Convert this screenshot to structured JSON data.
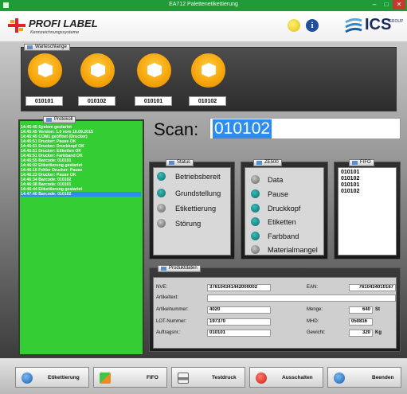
{
  "window": {
    "title": "EA712 Palettenetikettierung",
    "minimize": "–",
    "maximize": "□",
    "close": "✕"
  },
  "header": {
    "brand": "PROFI LABEL",
    "brand_sub": "Kennzeichnungssysteme",
    "partner": "ICS",
    "partner_suffix": "GROUP",
    "icons": [
      "moon-icon",
      "info-icon"
    ]
  },
  "queue": {
    "title": "Warteschlange",
    "items": [
      "010101",
      "010102",
      "010101",
      "010102"
    ]
  },
  "protokoll": {
    "title": "Protokoll",
    "lines": [
      "14:45:45  System gestartet",
      "14:45:45  Version: 1.0 vom 10.09.2015",
      "14:45:45  COM1 geöffnet (Drucker)",
      "14:45:51  Drucker: Pause OK",
      "14:45:51  Drucker: Druckkopf OK",
      "14:45:51  Drucker: Etiketten OK",
      "14:45:51  Drucker: Farbband OK",
      "14:45:55  Barcode: 010101",
      "14:46:02  Etikettierung gestartet",
      "14:46:16  Fehler Drucker: Pause",
      "14:46:23  Drucker: Pause OK",
      "14:46:34  Barcode: 010102",
      "14:46:38  Barcode: 010101",
      "14:46:44  Etikettierung gestartet",
      "14:47:40  Barcode: 010102"
    ],
    "selected_index": 14
  },
  "scan": {
    "label": "Scan:",
    "value": "010102"
  },
  "status": {
    "title": "Status",
    "items": [
      {
        "label": "Betriebsbereit",
        "state": "teal"
      },
      {
        "label": "Grundstellung",
        "state": "teal"
      },
      {
        "label": "Etikettierung",
        "state": "grey"
      },
      {
        "label": "Störung",
        "state": "grey"
      }
    ]
  },
  "ze500": {
    "title": "ZE500",
    "items": [
      {
        "label": "Data",
        "state": "grey"
      },
      {
        "label": "Pause",
        "state": "teal"
      },
      {
        "label": "Druckkopf",
        "state": "teal"
      },
      {
        "label": "Etiketten",
        "state": "teal"
      },
      {
        "label": "Farbband",
        "state": "teal"
      },
      {
        "label": "Materialmangel",
        "state": "grey"
      }
    ]
  },
  "fifo": {
    "title": "FIFO",
    "items": [
      "010101",
      "010102",
      "010101",
      "010102"
    ]
  },
  "produktdaten": {
    "title": "Produktdaten",
    "nve_label": "NVE:",
    "nve": "376104341442000002",
    "ean_label": "EAN:",
    "ean": "7610434010167",
    "artikeltext_label": "Artikeltext:",
    "artikeltext": "",
    "artikelnummer_label": "Artikelnummer:",
    "artikelnummer": "4020",
    "menge_label": "Menge:",
    "menge": "640",
    "menge_unit": "St",
    "lot_label": "LOT-Nummer:",
    "lot": "197370",
    "mhd_label": "MHD:",
    "mhd": "050816",
    "auftrag_label": "Auftragsnr.:",
    "auftrag": "010101",
    "gewicht_label": "Gewicht:",
    "gewicht": "320",
    "gewicht_unit": "Kg"
  },
  "footer": {
    "buttons": [
      {
        "label": "Etikettierung",
        "icon": "start-icon"
      },
      {
        "label": "FIFO",
        "icon": "fifo-icon"
      },
      {
        "label": "Testdruck",
        "icon": "printer-icon"
      },
      {
        "label": "Ausschalten",
        "icon": "power-icon"
      },
      {
        "label": "Beenden",
        "icon": "exit-icon"
      }
    ]
  },
  "colors": {
    "titlebar": "#1f9b3a",
    "log_bg": "#34ce34",
    "selection": "#2e8cf0",
    "queue_circle": "#f5a40b",
    "led_on": "#0b6d6d"
  }
}
